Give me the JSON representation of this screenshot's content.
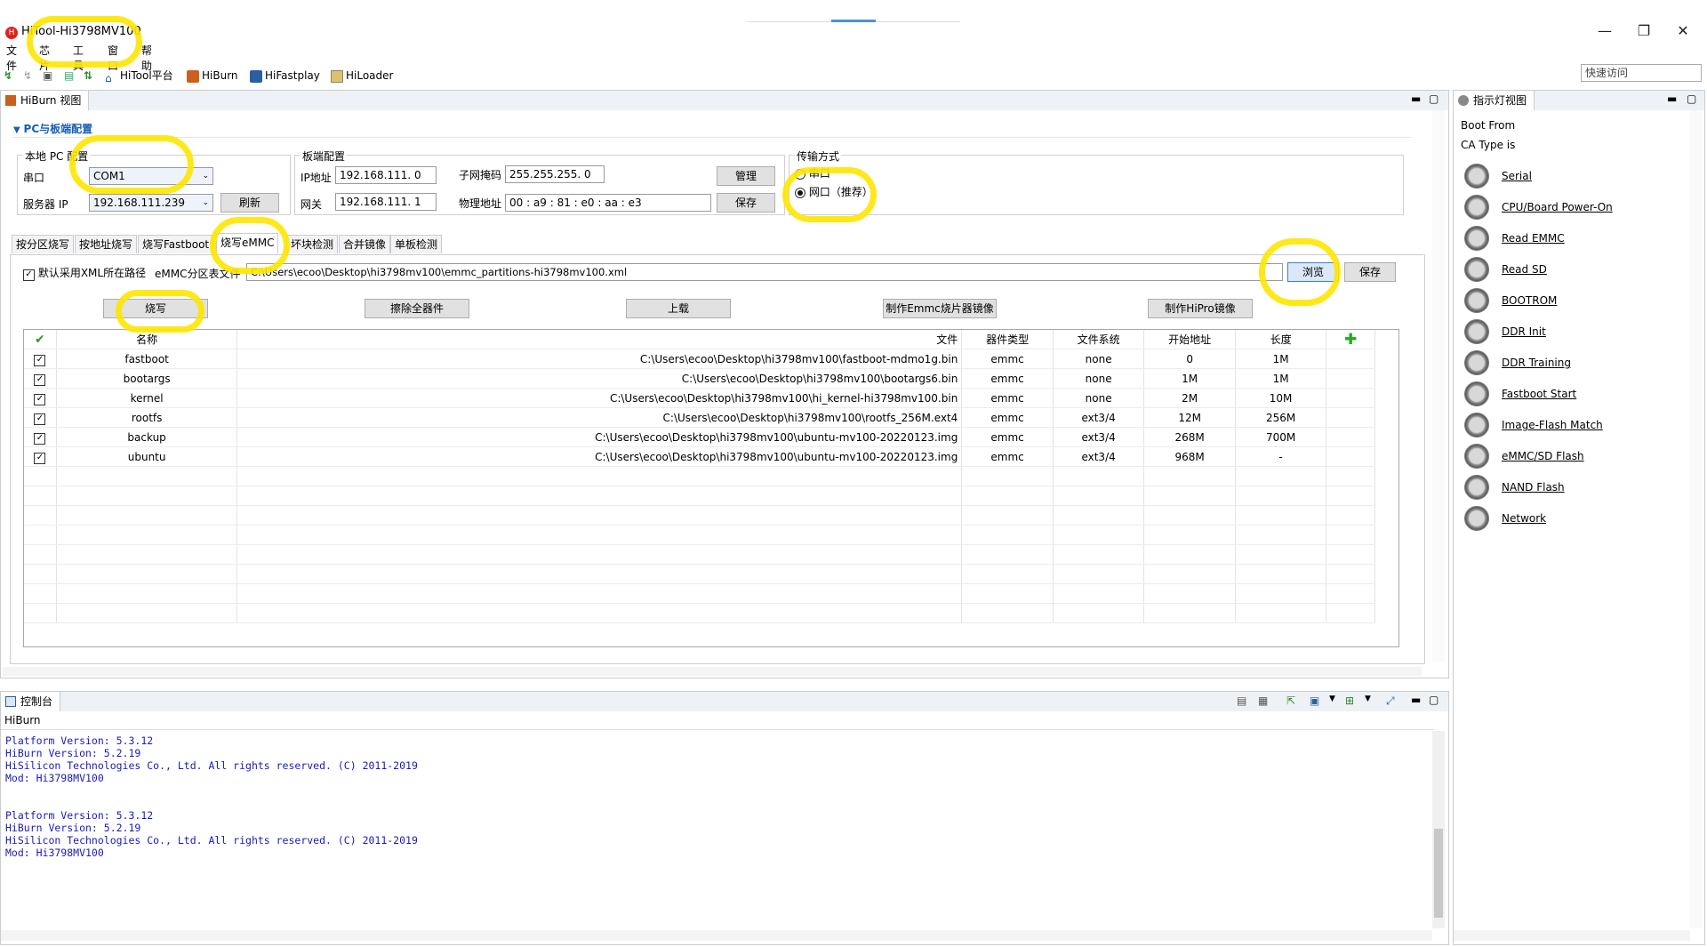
{
  "window": {
    "title": "HiTool-Hi3798MV100",
    "controls": [
      "—",
      "❐",
      "✕"
    ]
  },
  "menu": [
    "文件",
    "芯片",
    "工具",
    "窗口",
    "帮助"
  ],
  "toolbar": {
    "items": [
      "HiTool平台",
      "HiBurn",
      "HiFastplay",
      "HiLoader"
    ],
    "quick_access_placeholder": "快速访问"
  },
  "hiburn_view": {
    "tab_label": "HiBurn 视图",
    "section_title": "PC与板端配置",
    "local_pc": {
      "title": "本地 PC 配置",
      "serial_label": "串口",
      "serial_value": "COM1",
      "server_ip_label": "服务器 IP",
      "server_ip_value": "192.168.111.239",
      "refresh_label": "刷新"
    },
    "board": {
      "title": "板端配置",
      "ip_label": "IP地址",
      "ip_value": "192.168.111. 0",
      "gateway_label": "网关",
      "gateway_value": "192.168.111. 1",
      "mask_label": "子网掩码",
      "mask_value": "255.255.255. 0",
      "mac_label": "物理地址",
      "mac_value": "00 : a9 : 81 : e0 : aa : e3",
      "manage_label": "管理",
      "save_label": "保存"
    },
    "transfer": {
      "title": "传输方式",
      "serial_option": "串口",
      "network_option": "网口（推荐）"
    },
    "tabs": [
      "按分区烧写",
      "按地址烧写",
      "烧写Fastboot",
      "烧写eMMC",
      "坏块检测",
      "合并镜像",
      "单板检测"
    ],
    "active_tab": "烧写eMMC",
    "xml": {
      "checkbox_label": "默认采用XML所在路径",
      "table_label": "eMMC分区表文件",
      "path_value": "C:\\Users\\ecoo\\Desktop\\hi3798mv100\\emmc_partitions-hi3798mv100.xml",
      "browse_label": "浏览",
      "save_label": "保存"
    },
    "actions": [
      "烧写",
      "擦除全器件",
      "上载",
      "制作Emmc烧片器镜像",
      "制作HiPro镜像"
    ],
    "table": {
      "headers": [
        "名称",
        "文件",
        "器件类型",
        "文件系统",
        "开始地址",
        "长度"
      ],
      "rows": [
        {
          "name": "fastboot",
          "file": "C:\\Users\\ecoo\\Desktop\\hi3798mv100\\fastboot-mdmo1g.bin",
          "device": "emmc",
          "fs": "none",
          "start": "0",
          "length": "1M"
        },
        {
          "name": "bootargs",
          "file": "C:\\Users\\ecoo\\Desktop\\hi3798mv100\\bootargs6.bin",
          "device": "emmc",
          "fs": "none",
          "start": "1M",
          "length": "1M"
        },
        {
          "name": "kernel",
          "file": "C:\\Users\\ecoo\\Desktop\\hi3798mv100\\hi_kernel-hi3798mv100.bin",
          "device": "emmc",
          "fs": "none",
          "start": "2M",
          "length": "10M"
        },
        {
          "name": "rootfs",
          "file": "C:\\Users\\ecoo\\Desktop\\hi3798mv100\\rootfs_256M.ext4",
          "device": "emmc",
          "fs": "ext3/4",
          "start": "12M",
          "length": "256M"
        },
        {
          "name": "backup",
          "file": "C:\\Users\\ecoo\\Desktop\\hi3798mv100\\ubuntu-mv100-20220123.img",
          "device": "emmc",
          "fs": "ext3/4",
          "start": "268M",
          "length": "700M"
        },
        {
          "name": "ubuntu",
          "file": "C:\\Users\\ecoo\\Desktop\\hi3798mv100\\ubuntu-mv100-20220123.img",
          "device": "emmc",
          "fs": "ext3/4",
          "start": "968M",
          "length": "-"
        }
      ]
    }
  },
  "console": {
    "tab_label": "控制台",
    "source": "HiBurn",
    "lines": [
      "Platform Version: 5.3.12",
      "HiBurn Version: 5.2.19",
      "HiSilicon Technologies Co., Ltd. All rights reserved. (C) 2011-2019",
      "Mod: Hi3798MV100",
      "",
      "",
      "Platform Version: 5.3.12",
      "HiBurn Version: 5.2.19",
      "HiSilicon Technologies Co., Ltd. All rights reserved. (C) 2011-2019",
      "Mod: Hi3798MV100"
    ]
  },
  "indicator_view": {
    "tab_label": "指示灯视图",
    "boot_from": "Boot From",
    "ca_type": "CA Type is",
    "items": [
      "Serial",
      "CPU/Board Power-On",
      "Read EMMC",
      "Read SD ",
      "BOOTROM",
      "DDR Init",
      "DDR Training",
      "Fastboot Start",
      "Image-Flash Match",
      "eMMC/SD Flash",
      "NAND Flash",
      "Network"
    ]
  },
  "colors": {
    "highlight": "#ffe600",
    "console_text": "#1a1ab8",
    "section_title": "#1a5fb4",
    "add_icon": "#22aa22"
  }
}
